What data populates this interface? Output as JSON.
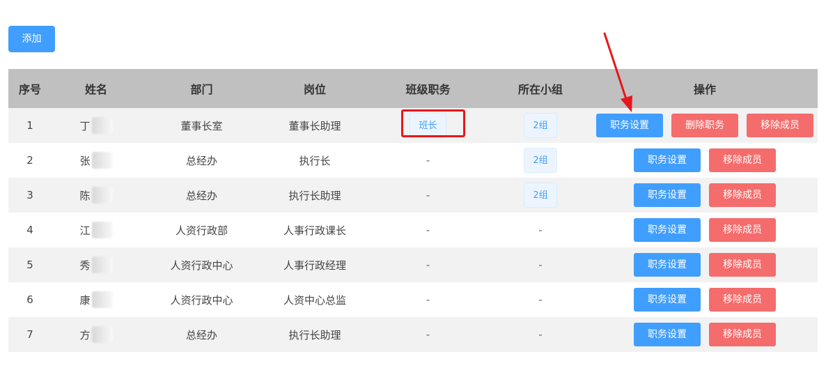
{
  "toolbar": {
    "add_label": "添加"
  },
  "table": {
    "headers": [
      "序号",
      "姓名",
      "部门",
      "岗位",
      "班级职务",
      "所在小组",
      "操作"
    ],
    "rows": [
      {
        "index": "1",
        "name": "丁",
        "department": "董事长室",
        "position": "董事长助理",
        "class_role": "班长",
        "group": "2组",
        "actions": [
          "职务设置",
          "删除职务",
          "移除成员"
        ]
      },
      {
        "index": "2",
        "name": "张",
        "department": "总经办",
        "position": "执行长",
        "class_role": "-",
        "group": "2组",
        "actions": [
          "职务设置",
          "移除成员"
        ]
      },
      {
        "index": "3",
        "name": "陈",
        "department": "总经办",
        "position": "执行长助理",
        "class_role": "-",
        "group": "2组",
        "actions": [
          "职务设置",
          "移除成员"
        ]
      },
      {
        "index": "4",
        "name": "江",
        "department": "人资行政部",
        "position": "人事行政课长",
        "class_role": "-",
        "group": "-",
        "actions": [
          "职务设置",
          "移除成员"
        ]
      },
      {
        "index": "5",
        "name": "秀",
        "department": "人资行政中心",
        "position": "人事行政经理",
        "class_role": "-",
        "group": "-",
        "actions": [
          "职务设置",
          "移除成员"
        ]
      },
      {
        "index": "6",
        "name": "康",
        "department": "人资行政中心",
        "position": "人资中心总监",
        "class_role": "-",
        "group": "-",
        "actions": [
          "职务设置",
          "移除成员"
        ]
      },
      {
        "index": "7",
        "name": "方",
        "department": "总经办",
        "position": "执行长助理",
        "class_role": "-",
        "group": "-",
        "actions": [
          "职务设置",
          "移除成员"
        ]
      }
    ]
  },
  "colors": {
    "primary": "#409eff",
    "danger": "#f56c6c",
    "header_bg": "#c0c0c0",
    "annotation": "#e8161c"
  },
  "icons": {
    "annotation": "arrow-annotation-icon"
  }
}
